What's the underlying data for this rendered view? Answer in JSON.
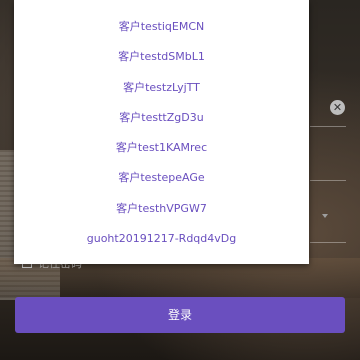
{
  "login_form": {
    "clear_icon_glyph": "✕",
    "remember_label": "记住密码",
    "login_button": "登录"
  },
  "account_popup": {
    "items": [
      "客户testiqEMCN",
      "客户testdSMbL1",
      "客户testzLyjTT",
      "客户testtZgD3u",
      "客户test1KAMrec",
      "客户testepeAGe",
      "客户testhVPGW7",
      "guoht20191217-Rdqd4vDg"
    ]
  },
  "colors": {
    "accent": "#6a4fbf",
    "popup_background": "#ffffff"
  }
}
